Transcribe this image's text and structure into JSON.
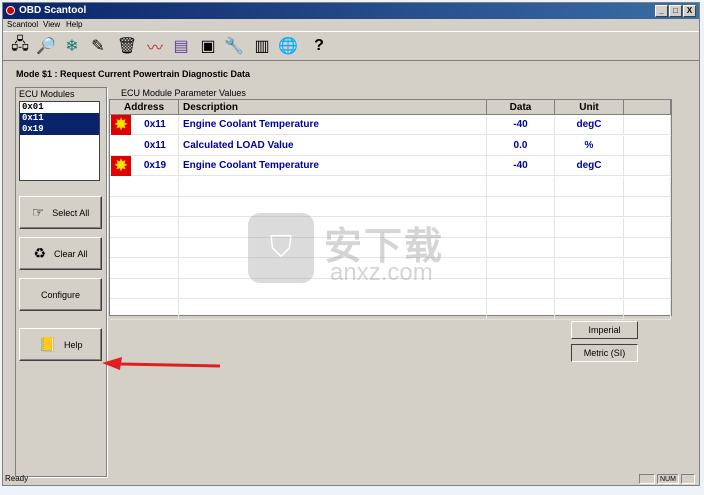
{
  "window": {
    "title": "OBD Scantool",
    "controls": [
      "_",
      "□",
      "X"
    ]
  },
  "menu": [
    "Scantool",
    "View",
    "Help"
  ],
  "toolbar_icons": [
    "connection-icon",
    "search-icon",
    "snowflake-icon",
    "pen-icon",
    "trash-icon",
    "graph-icon",
    "chart-icon",
    "report-icon",
    "wrench-icon",
    "barcode-icon",
    "globe-icon",
    "help-icon"
  ],
  "mode_title": "Mode $1 :  Request Current Powertrain Diagnostic Data",
  "ecu": {
    "label": "ECU Modules",
    "items": [
      {
        "text": "0x01",
        "selected": false
      },
      {
        "text": "0x11",
        "selected": true
      },
      {
        "text": "0x19",
        "selected": true
      }
    ]
  },
  "buttons": {
    "select_all": "Select All",
    "clear_all": "Clear All",
    "configure": "Configure",
    "help": "Help"
  },
  "params": {
    "label": "ECU Module Parameter Values",
    "headers": [
      "Address",
      "Description",
      "Data",
      "Unit"
    ],
    "rows": [
      {
        "flag": true,
        "address": "0x11",
        "description": "Engine Coolant Temperature",
        "data": "-40",
        "unit": "degC"
      },
      {
        "flag": false,
        "address": "0x11",
        "description": "Calculated LOAD Value",
        "data": "0.0",
        "unit": "%"
      },
      {
        "flag": true,
        "address": "0x19",
        "description": "Engine Coolant Temperature",
        "data": "-40",
        "unit": "degC"
      }
    ]
  },
  "units": {
    "imperial": "Imperial",
    "metric": "Metric (SI)",
    "selected": "metric"
  },
  "status": {
    "text": "Ready",
    "num": "NUM"
  },
  "watermark": {
    "cn": "安下载",
    "en": "anxz.com"
  },
  "colors": {
    "title_bar": "#0a246a",
    "data_text": "#0000a0",
    "flag_bg": "#e00000",
    "arrow": "#e02020"
  }
}
